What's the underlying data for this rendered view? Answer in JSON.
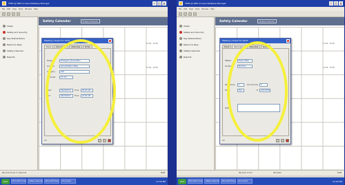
{
  "window": {
    "title": "TEPS @ NIPS Access Database Manager"
  },
  "menu": [
    "File",
    "Edit",
    "View",
    "Tools",
    "Window",
    "Help"
  ],
  "sidebar": {
    "items": [
      {
        "label": "Views"
      },
      {
        "label": "Safety and Security"
      },
      {
        "label": "Key Stakeholders"
      },
      {
        "label": "Resource Keys"
      },
      {
        "label": "Safety Calendar"
      },
      {
        "label": "Reports"
      }
    ]
  },
  "calendar": {
    "title": "Safety Calendar",
    "button": "Today's Events",
    "left_notes": [
      "11:00 - 10:00",
      "11:00 - 10:00"
    ],
    "right_notes": [
      "11:00 - 10:00",
      "11:00 - 10:00"
    ]
  },
  "left_dialog": {
    "title": "Meeting / Event for 2010",
    "tabs": [
      "Event",
      "Recurrence",
      "Attendees",
      "Notes"
    ],
    "fields": [
      {
        "label": "Subject",
        "value": "Emergency Evacuation"
      },
      {
        "label": "Location",
        "value": "Administration Bldg"
      },
      {
        "label": "Category",
        "value": "Drill"
      },
      {
        "label": "Reminder",
        "value": "15 min"
      }
    ],
    "dates": [
      {
        "label": "Start",
        "value": "09/24/2010",
        "time_label": "Time",
        "time": "09:00 AM"
      },
      {
        "label": "End",
        "value": "09/24/2010",
        "time_label": "Time",
        "time": "10:00 AM"
      }
    ],
    "footer": "OK"
  },
  "right_dialog": {
    "title": "Meeting / Event for 2010",
    "tabs": [
      "Event",
      "Recurrence",
      "Attendees",
      "Notes"
    ],
    "fields": [
      {
        "label": "Pattern",
        "value": "Every Other"
      },
      {
        "label": "Duration",
        "value": "Monthly"
      }
    ],
    "recur": [
      {
        "label": "Recurrence",
        "value": "1",
        "extra_label": "Occurrences",
        "extra": "5"
      },
      {
        "label": "Every",
        "value": "Day",
        "extra_label": "of",
        "extra": "10/1/2010"
      }
    ],
    "notes_label": "Notes",
    "footer": "OK"
  },
  "status": {
    "left": "Records Found: 0 / Records",
    "right_a": "Records: 0 of 0",
    "right_b": "Windows",
    "num": "NUM"
  },
  "taskbar": {
    "start": "start",
    "items": [
      "Microsoft Access",
      "Safety Calendar",
      "Microsoft PowerPoint",
      "Document"
    ],
    "clock": "12:00 PM"
  },
  "colors": {
    "highlight": "#f5f03a",
    "titlebar": "#1f3fa8",
    "taskbar": "#244bb8"
  }
}
